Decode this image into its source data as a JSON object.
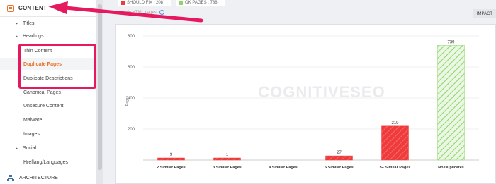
{
  "sidebar": {
    "header_label": "CONTENT",
    "items": [
      {
        "label": "Titles",
        "arrow": "▸",
        "sub": false,
        "active": false
      },
      {
        "label": "Headings",
        "arrow": "▸",
        "sub": false,
        "active": false
      },
      {
        "label": "Thin Content",
        "arrow": "",
        "sub": true,
        "active": false
      },
      {
        "label": "Duplicate Pages",
        "arrow": "",
        "sub": true,
        "active": true
      },
      {
        "label": "Duplicate Descriptions",
        "arrow": "",
        "sub": true,
        "active": false
      },
      {
        "label": "Canonical Pages",
        "arrow": "",
        "sub": true,
        "active": false
      },
      {
        "label": "Unsecure Content",
        "arrow": "",
        "sub": true,
        "active": false
      },
      {
        "label": "Malware",
        "arrow": "",
        "sub": true,
        "active": false
      },
      {
        "label": "Images",
        "arrow": "",
        "sub": true,
        "active": false
      },
      {
        "label": "Social",
        "arrow": "▸",
        "sub": false,
        "active": false
      },
      {
        "label": "Hreflang/Languages",
        "arrow": "",
        "sub": true,
        "active": false
      }
    ],
    "footer_label": "ARCHITECTURE"
  },
  "topbar": {
    "should_fix": "SHOULD FIX : 208",
    "ok_pages": "OK PAGES : 738",
    "subtitle": "only HTML pages",
    "impact_label": "IMPACT"
  },
  "colors": {
    "accent": "#e8742c",
    "highlight": "#e6195e",
    "bar_red": "#ef3b3b",
    "bar_green": "#8ed36b"
  },
  "chart_data": {
    "type": "bar",
    "categories": [
      "2 Similar Pages",
      "3 Similar Pages",
      "4 Similar Pages",
      "5 Similar Pages",
      "5+ Similar Pages",
      "No Duplicates"
    ],
    "values": [
      9,
      1,
      null,
      27,
      219,
      739
    ],
    "data_labels": [
      "9",
      "1",
      "",
      "27",
      "219",
      "739"
    ],
    "bar_styles": [
      "red",
      "red",
      "red",
      "red",
      "red",
      "green"
    ],
    "ylabel": "Pages",
    "yticks": [
      "800",
      "600",
      "400",
      "200"
    ],
    "ylim": [
      0,
      800
    ],
    "watermark": "COGNITIVESEO",
    "grid": true
  }
}
